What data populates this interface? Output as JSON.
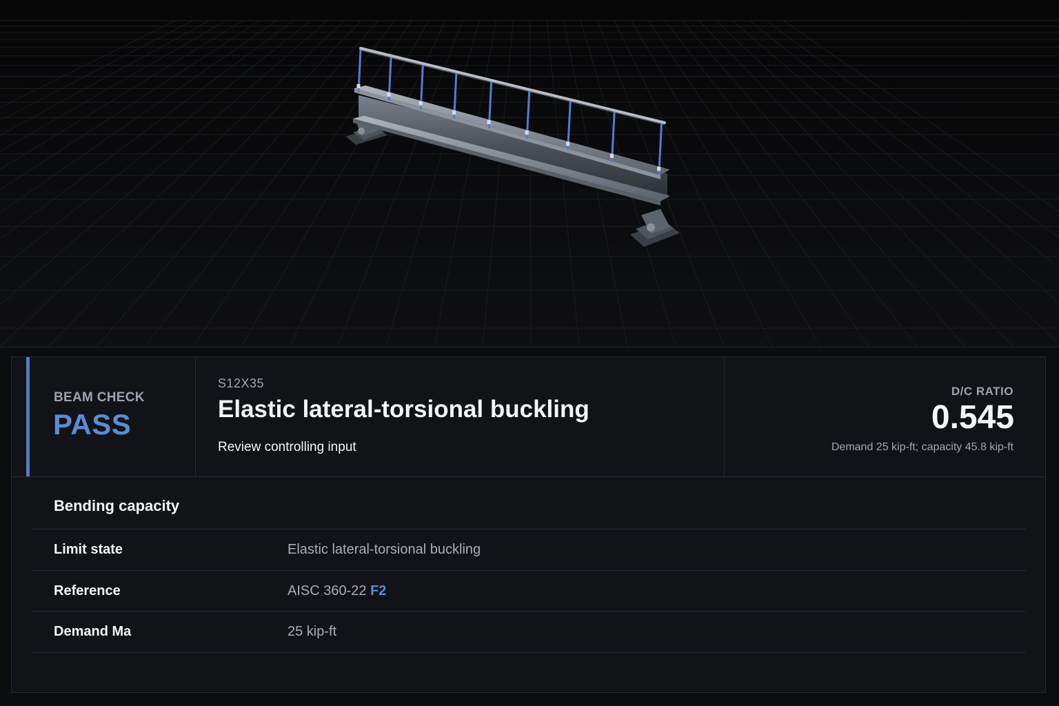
{
  "status": {
    "kicker": "BEAM CHECK",
    "value": "PASS",
    "accent_color": "#4f7ec4"
  },
  "header": {
    "section_code": "S12X35",
    "title": "Elastic lateral-torsional buckling",
    "review_link": "Review controlling input"
  },
  "ratio": {
    "label": "D/C RATIO",
    "value": "0.545",
    "detail": "Demand 25 kip-ft; capacity 45.8 kip-ft"
  },
  "details": {
    "heading": "Bending capacity",
    "rows": [
      {
        "label": "Limit state",
        "value": "Elastic lateral-torsional buckling"
      },
      {
        "label": "Reference",
        "value": "AISC 360-22 ",
        "link": "F2"
      },
      {
        "label": "Demand Ma",
        "value": "25 kip-ft"
      }
    ]
  },
  "viewport": {
    "model": "steel I-beam with guardrail posts on two bearing supports",
    "beam_color": "#5a606a",
    "post_color": "#3f6fb8"
  }
}
